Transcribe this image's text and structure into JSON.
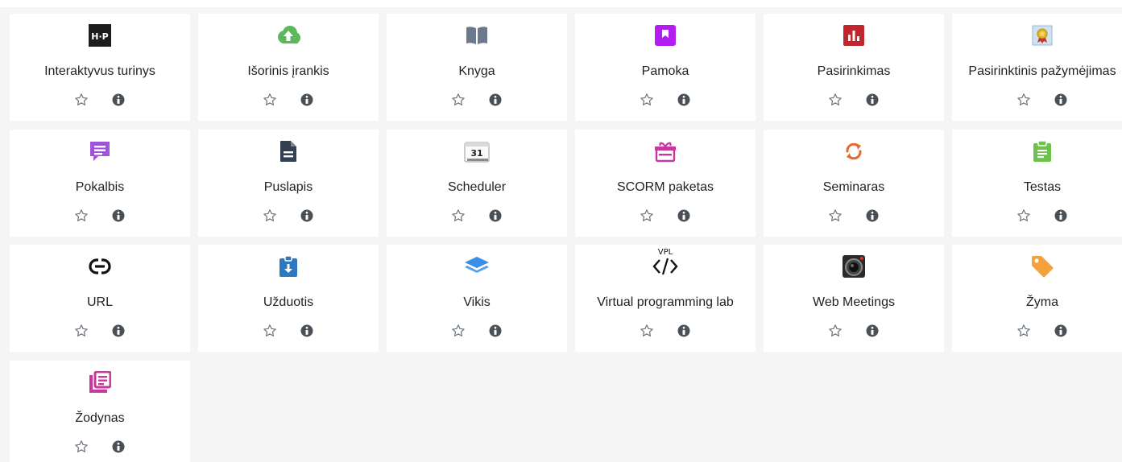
{
  "modules": [
    {
      "label": "Interaktyvus turinys",
      "icon": "h5p-icon"
    },
    {
      "label": "Išorinis įrankis",
      "icon": "upload-cloud-icon"
    },
    {
      "label": "Knyga",
      "icon": "book-icon"
    },
    {
      "label": "Pamoka",
      "icon": "lesson-bookmark-icon"
    },
    {
      "label": "Pasirinkimas",
      "icon": "bar-chart-icon"
    },
    {
      "label": "Pasirinktinis pažymėjimas",
      "icon": "certificate-icon"
    },
    {
      "label": "Pokalbis",
      "icon": "chat-bubble-icon"
    },
    {
      "label": "Puslapis",
      "icon": "page-document-icon"
    },
    {
      "label": "Scheduler",
      "icon": "calendar-icon",
      "calendar_day": "31"
    },
    {
      "label": "SCORM paketas",
      "icon": "scorm-package-icon"
    },
    {
      "label": "Seminaras",
      "icon": "refresh-arrows-icon"
    },
    {
      "label": "Testas",
      "icon": "quiz-clipboard-icon"
    },
    {
      "label": "URL",
      "icon": "link-icon"
    },
    {
      "label": "Užduotis",
      "icon": "assignment-download-icon"
    },
    {
      "label": "Vikis",
      "icon": "layers-icon"
    },
    {
      "label": "Virtual programming lab",
      "icon": "vpl-code-icon",
      "icon_text": "VPL"
    },
    {
      "label": "Web Meetings",
      "icon": "camera-lens-icon"
    },
    {
      "label": "Žyma",
      "icon": "tag-icon"
    },
    {
      "label": "Žodynas",
      "icon": "glossary-icon"
    }
  ],
  "colors": {
    "h5p": "#1d1d1d",
    "upload": "#5cb85c",
    "book": "#6a7a8c",
    "lesson": "#b31df2",
    "choice": "#c0262d",
    "chat": "#9e54d8",
    "page": "#344050",
    "scorm": "#c8379e",
    "refresh": "#e8692d",
    "quiz": "#6cc24a",
    "assignment": "#2a79c2",
    "layers": "#3a8ee6",
    "tag": "#f3a23c",
    "glossary": "#c8379e",
    "star": "#6a737b",
    "info": "#495057"
  }
}
